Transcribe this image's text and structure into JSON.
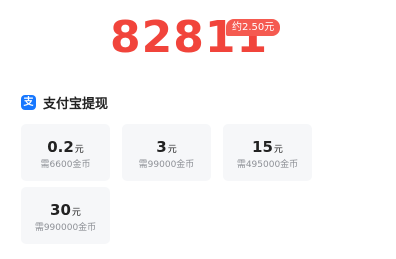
{
  "balance": {
    "coins": "82811",
    "rmb_estimate": "约2.50元",
    "amount_color": "#f1443b"
  },
  "withdraw": {
    "title": "支付宝提现",
    "icon": "alipay-icon",
    "icon_glyph": "支",
    "options": [
      {
        "value": "0.2",
        "unit": "元",
        "cost": "需6600金币"
      },
      {
        "value": "3",
        "unit": "元",
        "cost": "需99000金币"
      },
      {
        "value": "15",
        "unit": "元",
        "cost": "需495000金币"
      },
      {
        "value": "30",
        "unit": "元",
        "cost": "需990000金币"
      }
    ]
  }
}
